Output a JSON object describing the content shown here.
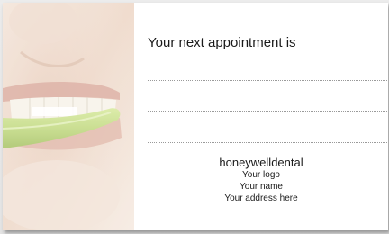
{
  "card": {
    "headline": "Your next appointment is",
    "brand": "honeywelldental",
    "logo_placeholder": "Your logo",
    "name_placeholder": "Your name",
    "address_placeholder": "Your address here"
  },
  "colors": {
    "background": "#e6e6e6",
    "card": "#ffffff",
    "text": "#1a1a1a",
    "dots": "#9a9a9a",
    "toothbrush": "#c7dd88",
    "skin": "#ecd6c6"
  },
  "image": {
    "subject": "smiling-mouth-with-toothbrush"
  }
}
